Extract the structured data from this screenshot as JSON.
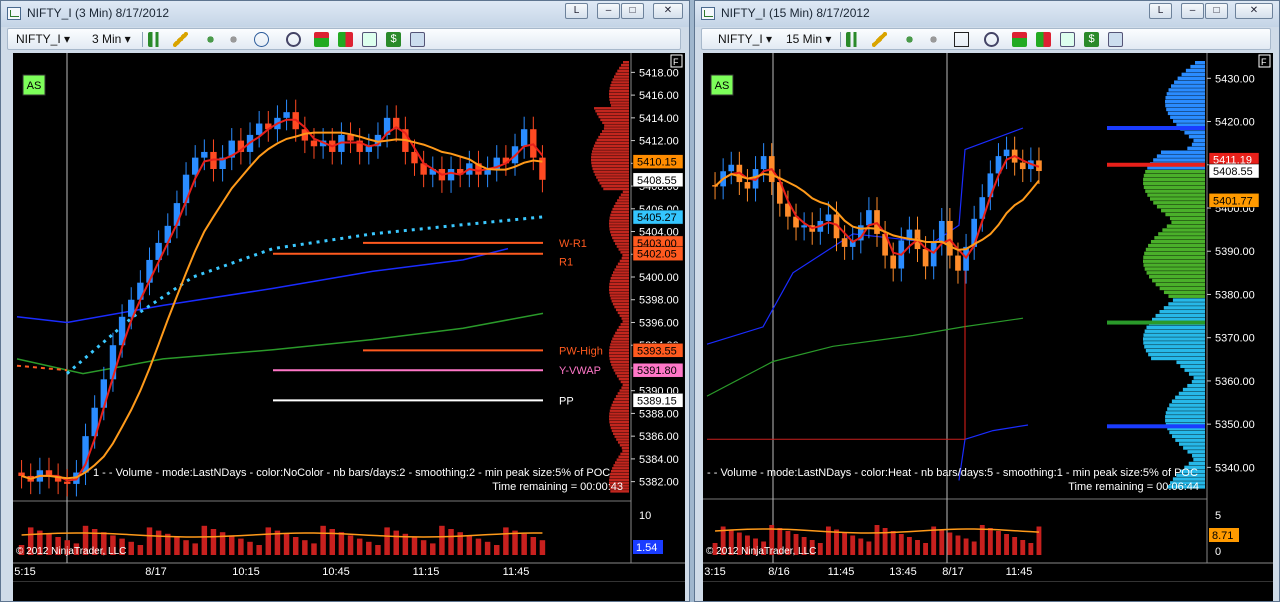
{
  "windows": [
    {
      "title": "NIFTY_I (3 Min)  8/17/2012",
      "instrument": "NIFTY_I",
      "interval": "3 Min",
      "controls": [
        "L",
        "□",
        "✕"
      ],
      "as_badge": "AS",
      "f_badge": "F",
      "indicator_text": "1 -  - Volume - mode:LastNDays  - color:NoColor - nb bars/days:2 - smoothing:2 - min peak size:5% of POC",
      "time_remaining": "Time remaining = 00:00:43",
      "copyright": "© 2012 NinjaTrader, LLC",
      "levels": [
        {
          "label": "W-R1",
          "price": 5403.0,
          "color": "#ff5a1f"
        },
        {
          "label": "R1",
          "price": 5402.05,
          "color": "#ff5a1f"
        },
        {
          "label": "PW-High",
          "price": 5393.55,
          "color": "#ff5a1f"
        },
        {
          "label": "Y-VWAP",
          "price": 5391.8,
          "color": "#ff77c8"
        },
        {
          "label": "PP",
          "price": 5389.15,
          "color": "#ffffff"
        }
      ],
      "price_tags": [
        {
          "text": "5410.15",
          "bg": "#ff8c00",
          "fg": "#000000",
          "price": 5410.15
        },
        {
          "text": "5408.55",
          "bg": "#ffffff",
          "fg": "#000000",
          "price": 5408.55
        },
        {
          "text": "5405.27",
          "bg": "#34c6ff",
          "fg": "#000000",
          "price": 5405.27
        },
        {
          "text": "5403.00",
          "bg": "#ff5a1f",
          "fg": "#000000",
          "price": 5403.0
        },
        {
          "text": "5402.05",
          "bg": "#ff5a1f",
          "fg": "#000000",
          "price": 5402.05
        },
        {
          "text": "5393.55",
          "bg": "#ff5a1f",
          "fg": "#000000",
          "price": 5393.55
        },
        {
          "text": "5391.80",
          "bg": "#ff77c8",
          "fg": "#000000",
          "price": 5391.8
        },
        {
          "text": "5389.15",
          "bg": "#ffffff",
          "fg": "#000000",
          "price": 5389.15
        }
      ],
      "volume_tags": [
        {
          "text": "1.54",
          "bg": "#1a3cff",
          "fg": "#ffffff"
        }
      ]
    },
    {
      "title": "NIFTY_I (15 Min)  8/17/2012",
      "instrument": "NIFTY_I",
      "interval": "15 Min",
      "controls": [
        "L",
        "□",
        "✕"
      ],
      "as_badge": "AS",
      "f_badge": "F",
      "indicator_text": "-  - Volume - mode:LastNDays  - color:Heat - nb bars/days:5 - smoothing:1 - min peak size:5% of POC",
      "time_remaining": "Time remaining = 00:06:44",
      "copyright": "© 2012 NinjaTrader, LLC",
      "levels": [],
      "price_tags": [
        {
          "text": "5411.19",
          "bg": "#e8201a",
          "fg": "#ffffff",
          "price": 5411.19
        },
        {
          "text": "5408.55",
          "bg": "#ffffff",
          "fg": "#000000",
          "price": 5408.55
        },
        {
          "text": "5401.77",
          "bg": "#ff9a00",
          "fg": "#000000",
          "price": 5401.77
        }
      ],
      "volume_tags": [
        {
          "text": "8.71",
          "bg": "#ff9a00",
          "fg": "#000000"
        }
      ]
    }
  ],
  "chart_data": [
    {
      "type": "candlestick",
      "title": "NIFTY_I (3 Min)  8/17/2012",
      "ylim": [
        5381,
        5419
      ],
      "y_ticks": [
        5418.0,
        5416.0,
        5414.0,
        5412.0,
        5410.0,
        5408.0,
        5406.0,
        5404.0,
        5402.0,
        5400.0,
        5398.0,
        5396.0,
        5394.0,
        5392.0,
        5390.0,
        5388.0,
        5386.0,
        5384.0,
        5382.0
      ],
      "x_tick_labels": [
        "5:15",
        "8/17",
        "10:15",
        "10:45",
        "11:15",
        "11:45"
      ],
      "volume_axis_ticks": [
        10
      ],
      "volume_last": 1.54,
      "close_series": [
        5382.5,
        5382.0,
        5383.0,
        5382.5,
        5382.0,
        5381.8,
        5382.8,
        5386.0,
        5388.5,
        5391.0,
        5394.0,
        5396.5,
        5398.0,
        5399.5,
        5401.5,
        5403.0,
        5404.5,
        5406.5,
        5409.0,
        5410.5,
        5411.0,
        5409.5,
        5410.5,
        5412.0,
        5411.0,
        5412.5,
        5413.5,
        5413.0,
        5414.0,
        5414.5,
        5413.0,
        5412.0,
        5411.5,
        5412.0,
        5411.0,
        5412.5,
        5412.0,
        5411.0,
        5411.5,
        5412.5,
        5414.0,
        5413.0,
        5411.0,
        5410.0,
        5409.0,
        5409.5,
        5408.5,
        5409.5,
        5409.0,
        5410.0,
        5409.0,
        5409.5,
        5410.5,
        5410.0,
        5411.5,
        5413.0,
        5410.5,
        5408.55
      ]
    },
    {
      "type": "candlestick",
      "title": "NIFTY_I (15 Min)  8/17/2012",
      "ylim": [
        5335,
        5434
      ],
      "y_ticks": [
        5430.0,
        5420.0,
        5410.0,
        5400.0,
        5390.0,
        5380.0,
        5370.0,
        5360.0,
        5350.0,
        5340.0
      ],
      "x_tick_labels": [
        "3:15",
        "8/16",
        "11:45",
        "13:45",
        "8/17",
        "11:45"
      ],
      "volume_axis_ticks": [
        5,
        0
      ],
      "volume_last": 8.71,
      "close_series": [
        5405.0,
        5408.5,
        5410.0,
        5406.0,
        5404.5,
        5409.0,
        5412.0,
        5406.0,
        5401.0,
        5398.0,
        5395.5,
        5396.0,
        5394.5,
        5397.0,
        5398.5,
        5393.0,
        5391.0,
        5392.5,
        5396.0,
        5399.5,
        5394.0,
        5389.0,
        5386.0,
        5392.5,
        5395.0,
        5390.5,
        5386.5,
        5392.0,
        5397.0,
        5389.0,
        5385.5,
        5391.0,
        5397.5,
        5402.5,
        5408.0,
        5412.0,
        5413.5,
        5410.5,
        5409.0,
        5411.0,
        5408.55
      ]
    }
  ]
}
